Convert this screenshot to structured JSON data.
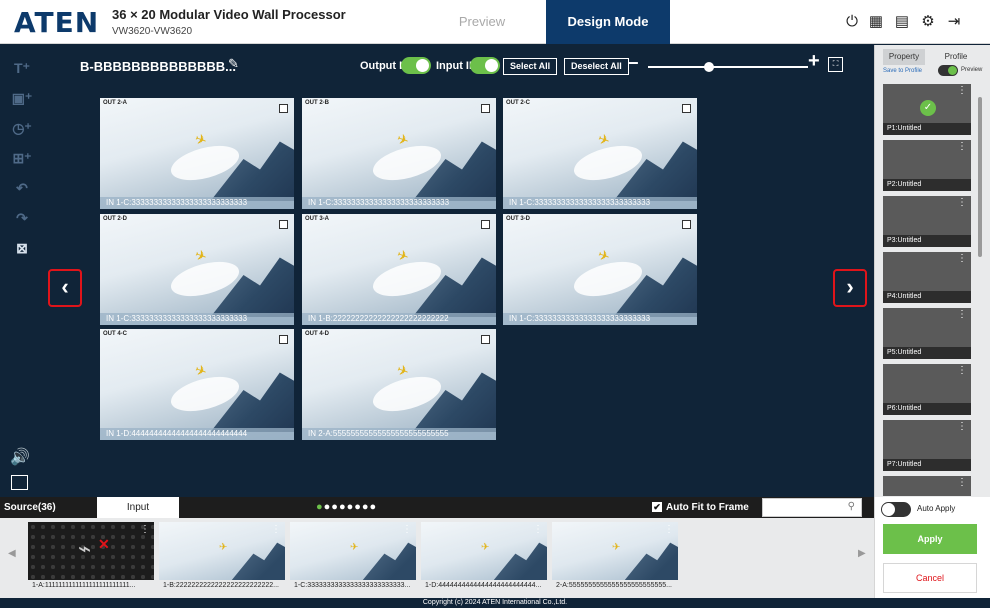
{
  "header": {
    "logo": "ATEN",
    "title": "36 × 20 Modular Video Wall Processor",
    "subtitle": "VW3620-VW3620",
    "tab_preview": "Preview",
    "tab_design": "Design Mode",
    "icons": [
      "power-icon",
      "grid-icon",
      "calendar-icon",
      "settings-icon",
      "logout-icon"
    ]
  },
  "toolbar": {
    "wall_name": "B-BBBBBBBBBBBBBB...",
    "output_id_label": "Output ID",
    "input_id_label": "Input ID",
    "select_all": "Select All",
    "deselect_all": "Deselect All"
  },
  "tiles": [
    {
      "label": "OUT 2-A",
      "source": "IN 1-C:33333333333333333333333333"
    },
    {
      "label": "OUT 2-B",
      "source": "IN 1-C:33333333333333333333333333"
    },
    {
      "label": "OUT 2-C",
      "source": "IN 1-C:33333333333333333333333333"
    },
    {
      "label": "OUT 2-D",
      "source": "IN 1-C:33333333333333333333333333"
    },
    {
      "label": "OUT 3-A",
      "source": "IN 1-B:22222222222222222222222222"
    },
    {
      "label": "OUT 3-D",
      "source": "IN 1-C:33333333333333333333333333"
    },
    {
      "label": "OUT 4-C",
      "source": "IN 1-D:44444444444444444444444444"
    },
    {
      "label": "OUT 4-D",
      "source": "IN 2-A:55555555555555555555555555"
    }
  ],
  "right_panel": {
    "tab_property": "Property",
    "tab_profile": "Profile",
    "save_to_profile": "Save to Profile",
    "preview_label": "Preview",
    "profiles": [
      "P1:Untitled",
      "P2:Untitled",
      "P3:Untitled",
      "P4:Untitled",
      "P5:Untitled",
      "P6:Untitled",
      "P7:Untitled"
    ]
  },
  "source_bar": {
    "title": "Source(36)",
    "tab_input": "Input",
    "auto_fit": "Auto Fit to Frame",
    "search_placeholder": "",
    "items": [
      "1-A:1111111111111111111111111...",
      "1-B:2222222222222222222222222...",
      "1-C:3333333333333333333333333...",
      "1-D:4444444444444444444444444...",
      "2-A:5555555555555555555555555..."
    ]
  },
  "apply_area": {
    "auto_apply": "Auto Apply",
    "apply": "Apply",
    "cancel": "Cancel"
  },
  "footer": "Copyright (c) 2024 ATEN International Co.,Ltd.",
  "colors": {
    "brand": "#0d3a6b",
    "accent": "#6cc04a",
    "alert": "#e0141a",
    "background": "#102438"
  }
}
